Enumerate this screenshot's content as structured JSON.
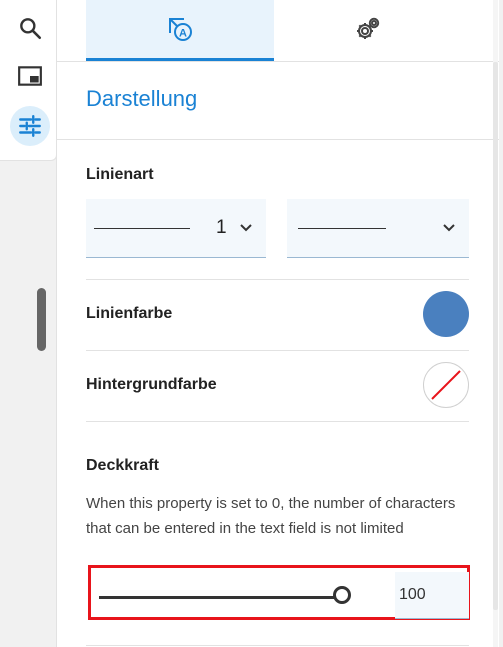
{
  "left_toolbar": {
    "tools": [
      {
        "icon": "search-icon",
        "active": false
      },
      {
        "icon": "panel-icon",
        "active": false
      },
      {
        "icon": "sliders-icon",
        "active": true
      }
    ]
  },
  "tabs": [
    {
      "icon": "style-icon",
      "active": true
    },
    {
      "icon": "settings-gear-icon",
      "active": false
    }
  ],
  "panel": {
    "title": "Darstellung",
    "line_style": {
      "label": "Linienart",
      "width_value": "1"
    },
    "line_color": {
      "label": "Linienfarbe",
      "color": "#4a80bf"
    },
    "background_color": {
      "label": "Hintergrundfarbe",
      "color": "none"
    },
    "opacity": {
      "label": "Deckkraft",
      "hint": "When this property is set to 0, the number of characters that can be entered in the text field is not limited",
      "value": "100"
    }
  },
  "colors": {
    "accent": "#1a82d4",
    "highlight": "#e8141b"
  }
}
